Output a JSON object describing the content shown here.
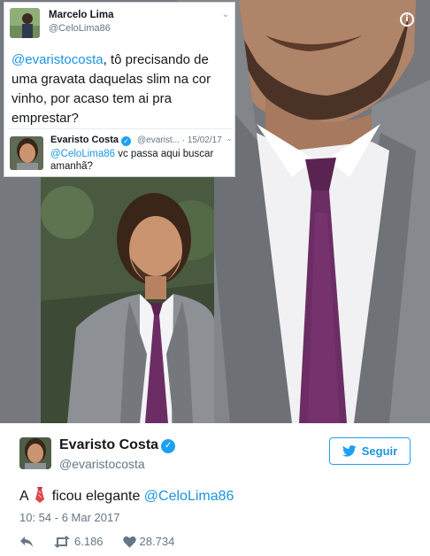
{
  "embedded_tweet": {
    "author_name": "Marcelo Lima",
    "author_handle": "@CeloLima86",
    "mention": "@evaristocosta",
    "text": ", tô precisando de uma gravata daquelas slim na cor vinho, por acaso tem ai pra emprestar?",
    "reply": {
      "author_name": "Evaristo Costa",
      "author_handle_date": "@evarist... · 15/02/17",
      "mention": "@CeloLima86",
      "text": " vc passa aqui buscar amanhã?"
    }
  },
  "tweet": {
    "author_name": "Evaristo Costa",
    "author_handle": "@evaristocosta",
    "follow_label": "Seguir",
    "text_before": "A",
    "text_after": "ficou elegante",
    "mention": "@CeloLima86",
    "timestamp": "10: 54 - 6 Mar 2017",
    "retweets": "6.186",
    "likes": "28.734"
  },
  "colors": {
    "accent": "#1da1f2",
    "link": "#1b95e0",
    "muted": "#657786",
    "like": "#657786"
  },
  "icons": [
    "info-icon",
    "chevron-down-icon",
    "verified-icon",
    "bird-icon",
    "necktie-emoji",
    "reply-icon",
    "retweet-icon",
    "heart-icon"
  ]
}
